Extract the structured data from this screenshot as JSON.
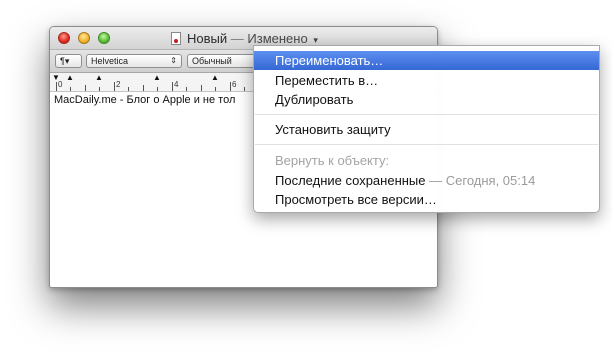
{
  "window": {
    "title": "Новый",
    "title_separator": "—",
    "title_status": "Изменено",
    "dropdown_caret": "▾"
  },
  "toolbar": {
    "paragraph_style": "¶▾",
    "font_family": "Helvetica",
    "font_style": "Обычный"
  },
  "ruler": {
    "numbers": [
      "0",
      "2",
      "4",
      "6"
    ]
  },
  "document": {
    "text": "MacDaily.me - Блог о Apple и не тол"
  },
  "menu": {
    "items": [
      {
        "label": "Переименовать…"
      },
      {
        "label": "Переместить в…"
      },
      {
        "label": "Дублировать"
      },
      {
        "label": "Установить защиту"
      },
      {
        "label": "Вернуть к объекту:"
      },
      {
        "label": "Последние сохраненные",
        "aux": "— Сегодня, 05:14"
      },
      {
        "label": "Просмотреть все версии…"
      }
    ]
  },
  "colors": {
    "highlight": "#3d72dc",
    "close": "#e0291f",
    "minimize": "#f0b32a",
    "zoom": "#58be34"
  }
}
